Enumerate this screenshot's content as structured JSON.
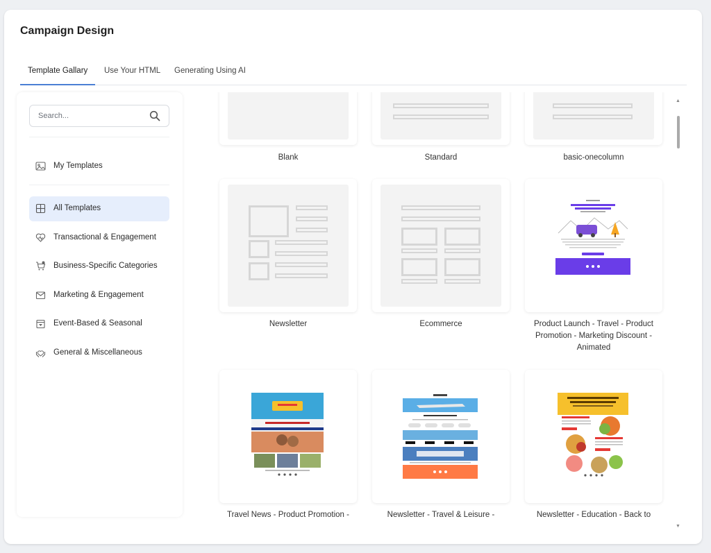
{
  "page": {
    "title": "Campaign Design"
  },
  "tabs": [
    {
      "label": "Template Gallary",
      "active": true
    },
    {
      "label": "Use Your HTML",
      "active": false
    },
    {
      "label": "Generating Using AI",
      "active": false
    }
  ],
  "sidebar": {
    "search_placeholder": "Search...",
    "my_templates": "My Templates",
    "categories": [
      {
        "label": "All Templates",
        "icon": "grid-icon",
        "active": true
      },
      {
        "label": "Transactional & Engagement",
        "icon": "heart-icon",
        "active": false
      },
      {
        "label": "Business-Specific Categories",
        "icon": "cart-icon",
        "active": false
      },
      {
        "label": "Marketing & Engagement",
        "icon": "mail-icon",
        "active": false
      },
      {
        "label": "Event-Based & Seasonal",
        "icon": "calendar-icon",
        "active": false
      },
      {
        "label": "General & Miscellaneous",
        "icon": "hands-icon",
        "active": false
      }
    ]
  },
  "templates": [
    {
      "label": "Blank"
    },
    {
      "label": "Standard"
    },
    {
      "label": "basic-onecolumn"
    },
    {
      "label": "Newsletter"
    },
    {
      "label": "Ecommerce"
    },
    {
      "label": "Product Launch - Travel - Product Promotion - Marketing Discount - Animated"
    },
    {
      "label": "Travel News - Product Promotion - Travel & Leisure - Memorial Day"
    },
    {
      "label": "Newsletter - Travel & Leisure - Marketing - Holiday"
    },
    {
      "label": "Newsletter - Education - Back to School"
    }
  ],
  "colors": {
    "accent": "#4a7fd4",
    "active_bg": "#e6eefc",
    "purple": "#6a3de8",
    "orange": "#ff7a45",
    "yellow": "#f6c02c"
  }
}
